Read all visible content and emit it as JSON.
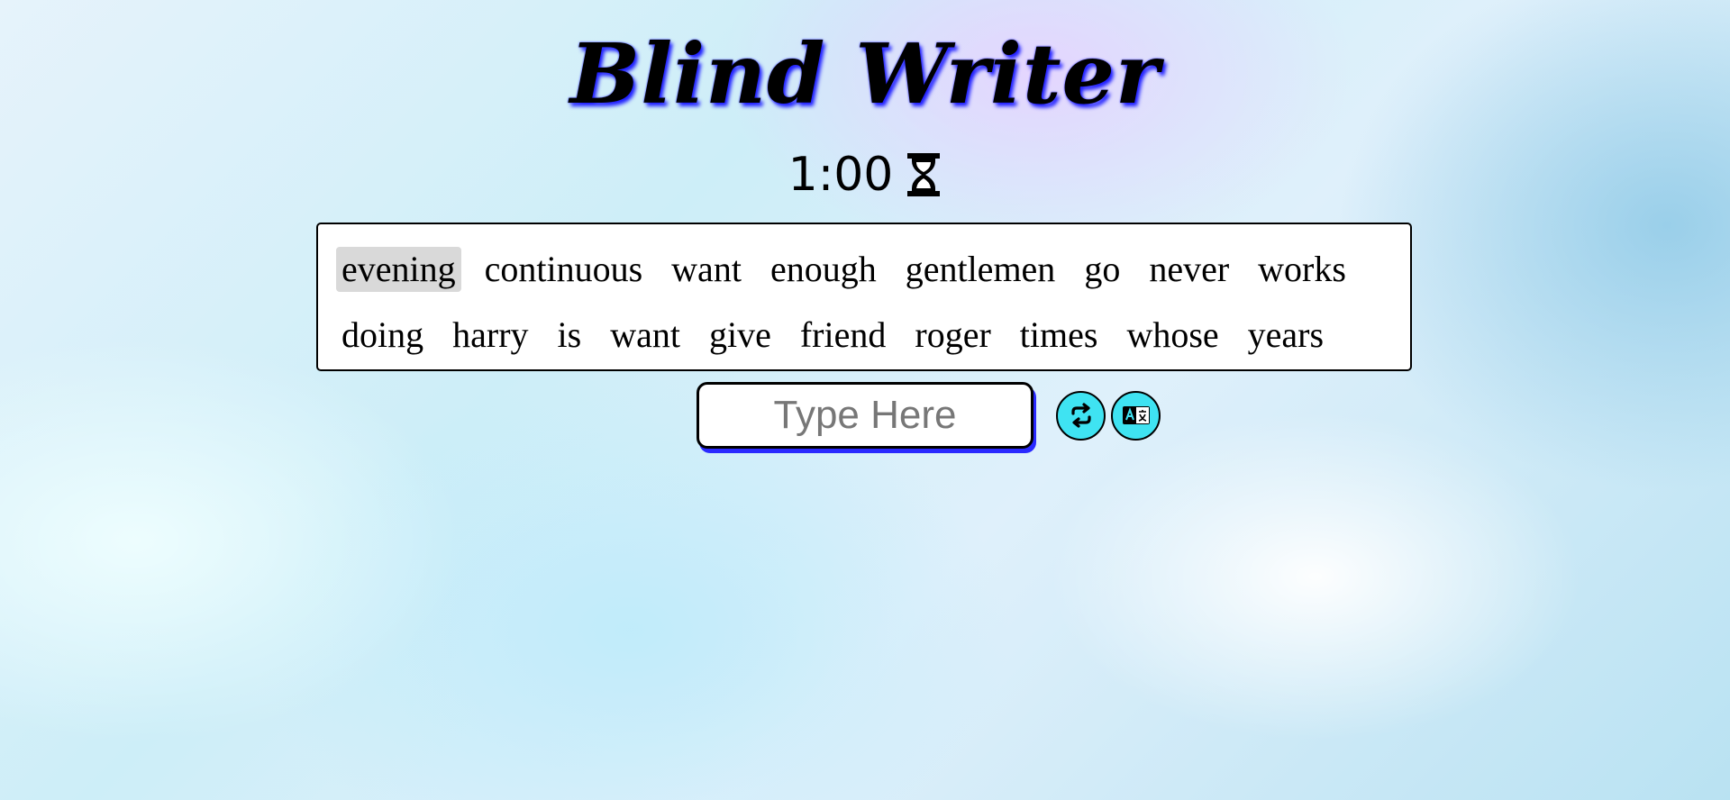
{
  "app": {
    "title": "Blind Writer"
  },
  "timer": {
    "value": "1:00",
    "icon": "hourglass-icon"
  },
  "words": {
    "lines": [
      [
        "evening",
        "continuous",
        "want",
        "enough",
        "gentlemen",
        "go",
        "never",
        "works"
      ],
      [
        "doing",
        "harry",
        "is",
        "want",
        "give",
        "friend",
        "roger",
        "times",
        "whose",
        "years"
      ]
    ],
    "active_word": "evening"
  },
  "input": {
    "placeholder": "Type Here",
    "value": ""
  },
  "buttons": [
    {
      "name": "restart",
      "icon": "repeat-icon"
    },
    {
      "name": "language",
      "icon": "translate-icon"
    }
  ],
  "colors": {
    "accent": "#3fe3f2",
    "shadow": "#2a2aff",
    "active_word_bg": "#d9d9d9"
  }
}
